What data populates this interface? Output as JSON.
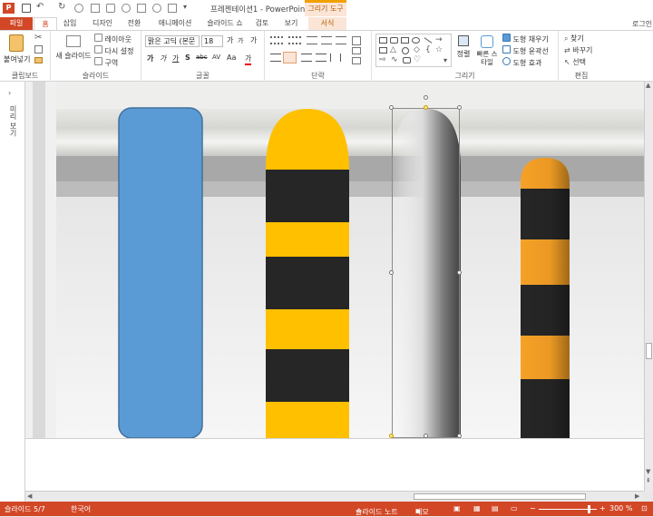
{
  "window": {
    "title": "프레젠테이션1 - PowerPoint",
    "context_tab": "그리기 도구",
    "right_label": "로그인"
  },
  "ribbon_tabs": [
    {
      "label": "파일"
    },
    {
      "label": "홈"
    },
    {
      "label": "삽입"
    },
    {
      "label": "디자인"
    },
    {
      "label": "전환"
    },
    {
      "label": "애니메이션"
    },
    {
      "label": "슬라이드 쇼"
    },
    {
      "label": "검토"
    },
    {
      "label": "보기"
    },
    {
      "label": "서식"
    }
  ],
  "clipboard": {
    "paste": "붙여넣기",
    "group": "클립보드"
  },
  "slides": {
    "new_slide": "새 슬라이드",
    "layout": "레이아웃",
    "reset": "다시 설정",
    "section": "구역",
    "group": "슬라이드"
  },
  "font": {
    "name": "맑은 고딕 (본문",
    "size": "18",
    "group": "글꼴",
    "bold": "가",
    "italic": "가",
    "underline": "가",
    "strike": "abc",
    "shadow": "S",
    "spacing": "AV",
    "case": "Aa",
    "color": "가",
    "grow": "가",
    "shrink": "가",
    "clear": "가"
  },
  "paragraph": {
    "group": "단락"
  },
  "drawing": {
    "arrange": "정렬",
    "quick_styles": "빠른 스타일",
    "fill": "도형 채우기",
    "outline": "도형 윤곽선",
    "effects": "도형 효과",
    "group": "그리기"
  },
  "editing": {
    "find": "찾기",
    "replace": "바꾸기",
    "select": "선택",
    "group": "편집"
  },
  "left_panel": {
    "label": "미리 보기"
  },
  "status": {
    "slide": "슬라이드 5/7",
    "language": "한국어",
    "notes": "슬라이드 노트",
    "comments": "메모",
    "zoom": "300 %"
  },
  "colors": {
    "accent": "#d24726",
    "blue": "#5b9bd5",
    "yellow": "#ffc000",
    "orange": "#f6a126",
    "black": "#262626"
  }
}
